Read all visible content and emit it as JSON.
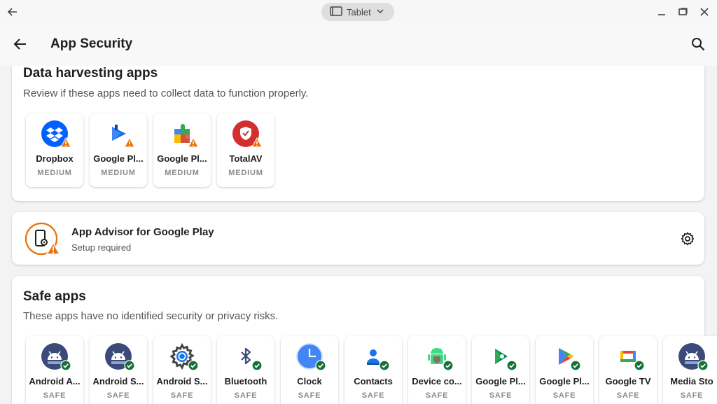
{
  "window": {
    "mode_label": "Tablet",
    "icons": [
      "arrow-left-icon",
      "tablet-icon",
      "chevron-down-icon",
      "minimize-icon",
      "restore-icon",
      "close-icon"
    ]
  },
  "appbar": {
    "title": "App Security",
    "icons": [
      "back-arrow-icon",
      "search-icon"
    ]
  },
  "harvesting": {
    "heading": "Data harvesting apps",
    "subtitle": "Review if these apps need to collect data to function properly.",
    "apps": [
      {
        "name": "Dropbox",
        "level": "MEDIUM",
        "icon": "dropbox-icon"
      },
      {
        "name": "Google Pl...",
        "level": "MEDIUM",
        "icon": "google-play-books-icon"
      },
      {
        "name": "Google Pl...",
        "level": "MEDIUM",
        "icon": "google-play-services-icon"
      },
      {
        "name": "TotalAV",
        "level": "MEDIUM",
        "icon": "totalav-icon"
      }
    ],
    "badge_icon": "warning-icon",
    "warning_color": "#e8710a"
  },
  "advisor": {
    "title": "App Advisor for Google Play",
    "subtitle": "Setup required",
    "icon": "phone-gear-warning-icon",
    "action_icon": "settings-gear-icon",
    "accent_color": "#e8710a"
  },
  "safe": {
    "heading": "Safe apps",
    "subtitle": "These apps have no identified security or privacy risks.",
    "apps": [
      {
        "name": "Android A...",
        "level": "SAFE",
        "icon": "android-icon"
      },
      {
        "name": "Android S...",
        "level": "SAFE",
        "icon": "android-icon"
      },
      {
        "name": "Android S...",
        "level": "SAFE",
        "icon": "android-settings-icon"
      },
      {
        "name": "Bluetooth",
        "level": "SAFE",
        "icon": "bluetooth-icon"
      },
      {
        "name": "Clock",
        "level": "SAFE",
        "icon": "clock-icon"
      },
      {
        "name": "Contacts",
        "level": "SAFE",
        "icon": "contacts-icon"
      },
      {
        "name": "Device co...",
        "level": "SAFE",
        "icon": "device-config-icon"
      },
      {
        "name": "Google Pl...",
        "level": "SAFE",
        "icon": "google-play-games-icon"
      },
      {
        "name": "Google Pl...",
        "level": "SAFE",
        "icon": "google-play-store-icon"
      },
      {
        "name": "Google TV",
        "level": "SAFE",
        "icon": "google-tv-icon"
      },
      {
        "name": "Media Sto",
        "level": "SAFE",
        "icon": "android-icon"
      }
    ],
    "badge_icon": "check-badge-icon",
    "safe_color": "#137333"
  }
}
